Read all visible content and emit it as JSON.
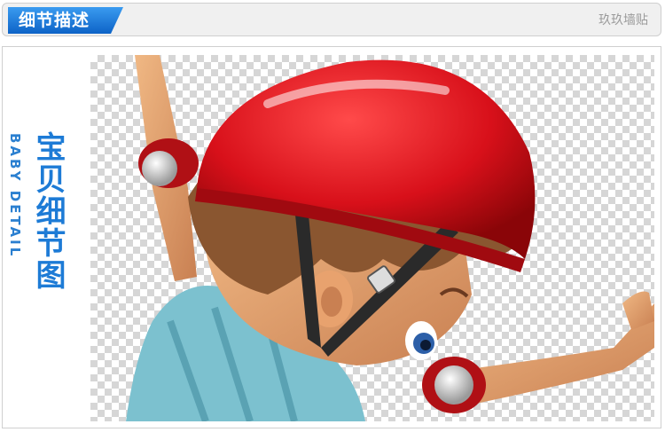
{
  "header": {
    "title": "细节描述",
    "brand": "玖玖墙贴"
  },
  "side": {
    "title_cn": "宝贝细节图",
    "title_en": "BABY DETAIL"
  },
  "colors": {
    "accent": "#1d7bd6",
    "helmet": "#d8101a",
    "checker": "#d6d6d6"
  }
}
